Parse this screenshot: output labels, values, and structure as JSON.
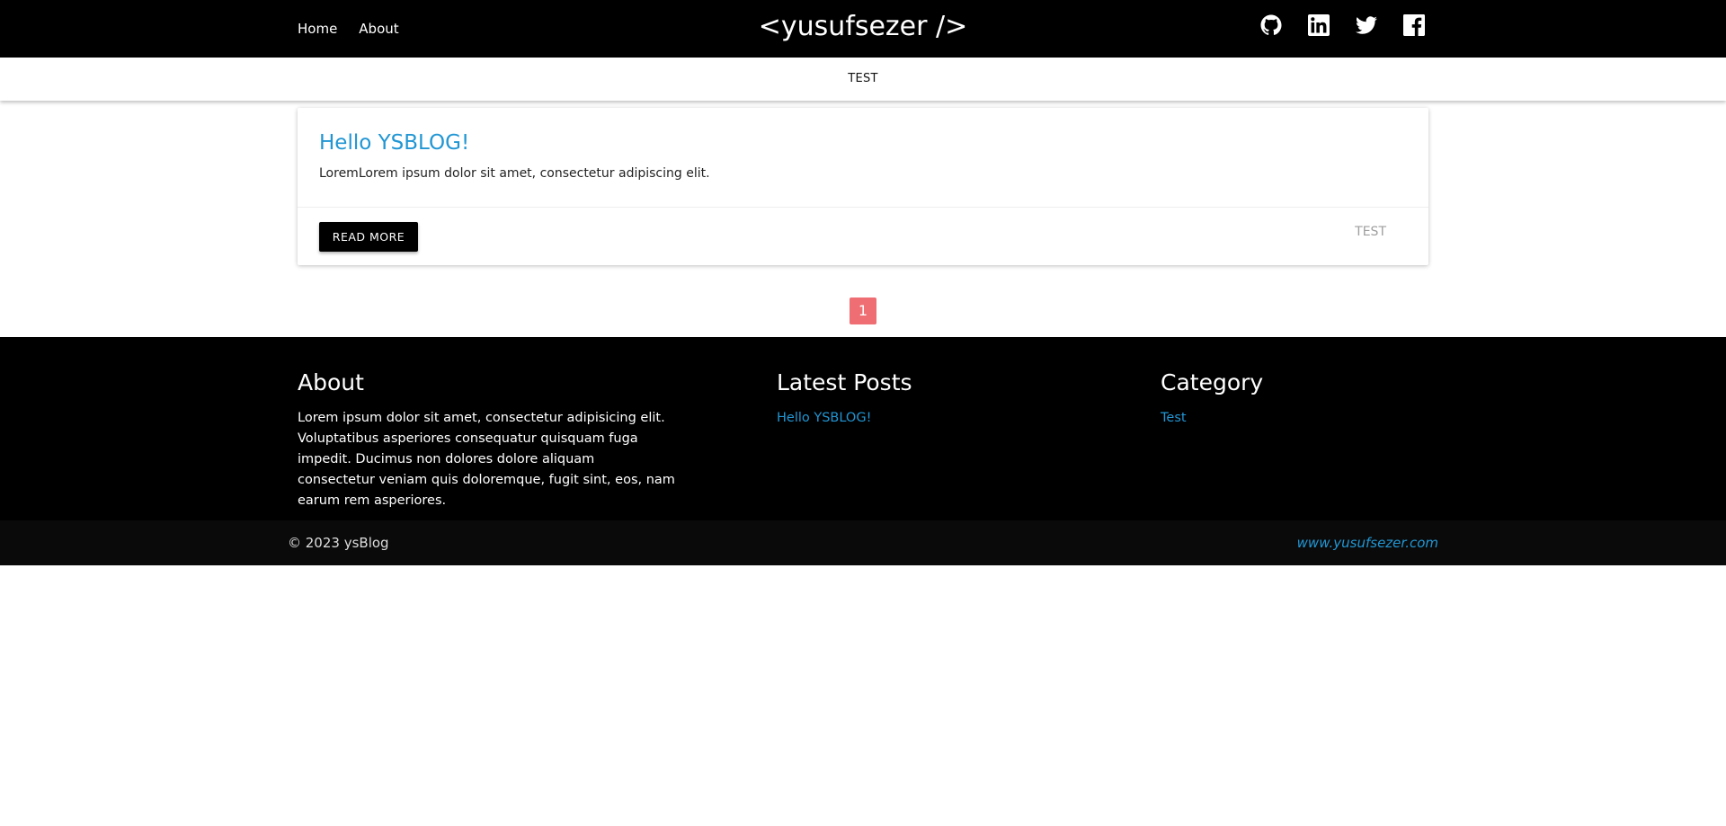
{
  "nav": {
    "links": [
      "Home",
      "About"
    ],
    "brand": "<yusufsezer />",
    "social_icons": [
      "github-icon",
      "linkedin-icon",
      "twitter-icon",
      "facebook-icon"
    ]
  },
  "category_bar": {
    "item": "TEST"
  },
  "post": {
    "title": "Hello YSBLOG!",
    "excerpt": "LoremLorem ipsum dolor sit amet, consectetur adipiscing elit.",
    "button": "READ MORE",
    "tag": "TEST"
  },
  "pagination": {
    "current": "1"
  },
  "footer": {
    "about": {
      "heading": "About",
      "text": "Lorem ipsum dolor sit amet, consectetur adipisicing elit. Voluptatibus asperiores consequatur quisquam fuga impedit. Ducimus non dolores dolore aliquam consectetur veniam quis doloremque, fugit sint, eos, nam earum rem asperiores."
    },
    "latest": {
      "heading": "Latest Posts",
      "items": [
        "Hello YSBLOG!"
      ]
    },
    "category": {
      "heading": "Category",
      "items": [
        "Test"
      ]
    },
    "copyright": "© 2023 ysBlog",
    "site": "www.yusufsezer.com"
  },
  "colors": {
    "link": "#2196d3",
    "pagination_active": "#ee6e73",
    "nav_bg": "#000000"
  }
}
